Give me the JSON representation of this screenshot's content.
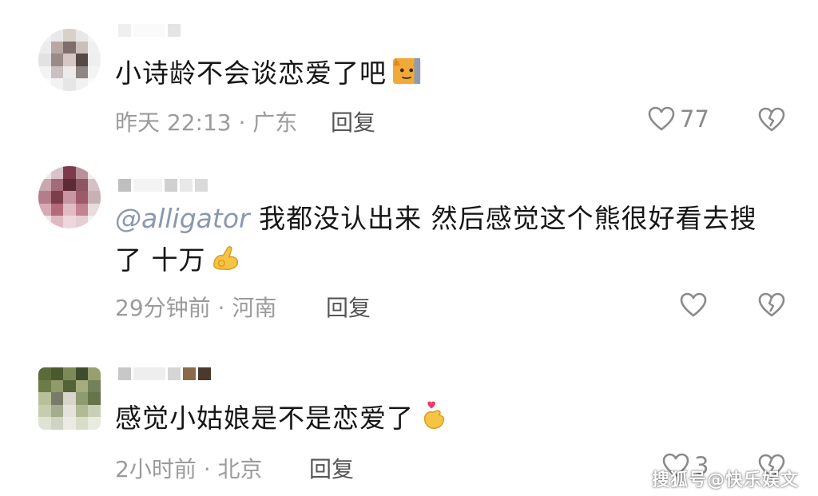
{
  "comments": [
    {
      "text": "小诗龄不会谈恋爱了吧",
      "time": "昨天 22:13",
      "location": "广东",
      "reply_label": "回复",
      "like_count": "77"
    },
    {
      "mention": "@alligator",
      "text_line1": "我都没认出来 然后感觉这个熊很好看去搜",
      "text_line2": "了 十万",
      "time": "29分钟前",
      "location": "河南",
      "reply_label": "回复",
      "like_count": ""
    },
    {
      "text": "感觉小姑娘是不是恋爱了",
      "time": "2小时前",
      "location": "北京",
      "reply_label": "回复",
      "like_count": "3"
    }
  ],
  "meta_separator": " · ",
  "watermark": "搜狐号@快乐娱文",
  "colors": {
    "text": "#161616",
    "meta": "#9b9b9b",
    "mention": "#8a97b0",
    "icon": "#8a8a8a"
  }
}
